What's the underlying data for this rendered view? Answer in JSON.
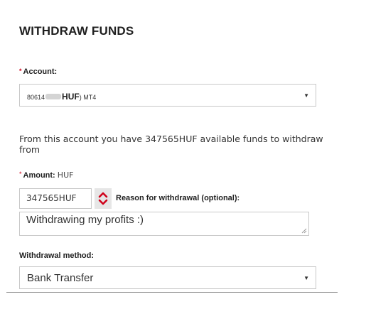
{
  "page": {
    "title": "WITHDRAW FUNDS"
  },
  "account": {
    "required_mark": "*",
    "label": "Account:",
    "number_prefix": "80614",
    "currency": "HUF",
    "type": ") MT4",
    "caret": "▼"
  },
  "info": {
    "text_before": "From this account you have ",
    "amount": "347565HUF",
    "text_after": "  available funds to withdraw from"
  },
  "amount": {
    "required_mark": "*",
    "label": "Amount:",
    "currency": "HUF",
    "value": "347565HUF"
  },
  "reason": {
    "label": "Reason for withdrawal (optional):",
    "value": "Withdrawing my profits :)"
  },
  "method": {
    "label": "Withdrawal method:",
    "selected": "Bank Transfer",
    "caret": "▼"
  },
  "colors": {
    "required": "#d0021b",
    "stepper_arrow": "#d0021b",
    "border": "#c8c8c8"
  },
  "icons": {
    "stepper": "up-down-arrow-icon",
    "caret": "caret-down-icon",
    "resize": "resize-grip-icon"
  }
}
